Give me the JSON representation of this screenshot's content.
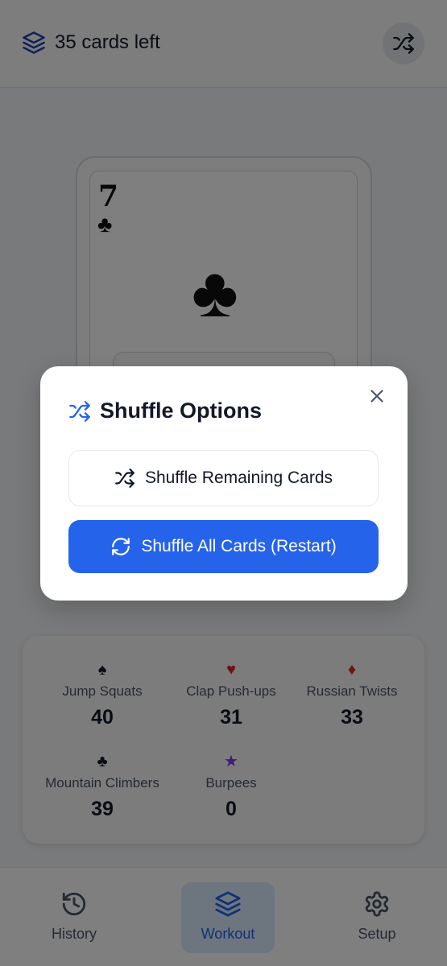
{
  "header": {
    "cards_left": "35 cards left"
  },
  "card": {
    "rank": "7",
    "suit": "♣",
    "suit_color": "#111111"
  },
  "stats": [
    {
      "suit": "♠",
      "color": "#111827",
      "name": "Jump Squats",
      "value": "40"
    },
    {
      "suit": "♥",
      "color": "#dc2626",
      "name": "Clap Push-ups",
      "value": "31"
    },
    {
      "suit": "♦",
      "color": "#dc2626",
      "name": "Russian Twists",
      "value": "33"
    },
    {
      "suit": "♣",
      "color": "#111827",
      "name": "Mountain Climbers",
      "value": "39"
    },
    {
      "suit": "★",
      "color": "#7c3aed",
      "name": "Burpees",
      "value": "0"
    }
  ],
  "nav": {
    "items": [
      {
        "label": "History",
        "icon": "history-icon"
      },
      {
        "label": "Workout",
        "icon": "layers-icon",
        "active": true
      },
      {
        "label": "Setup",
        "icon": "gear-icon"
      }
    ]
  },
  "modal": {
    "title": "Shuffle Options",
    "shuffle_remaining_label": "Shuffle Remaining Cards",
    "shuffle_all_label": "Shuffle All Cards (Restart)"
  },
  "colors": {
    "accent": "#2563eb",
    "accent_light": "#dbeafe"
  }
}
